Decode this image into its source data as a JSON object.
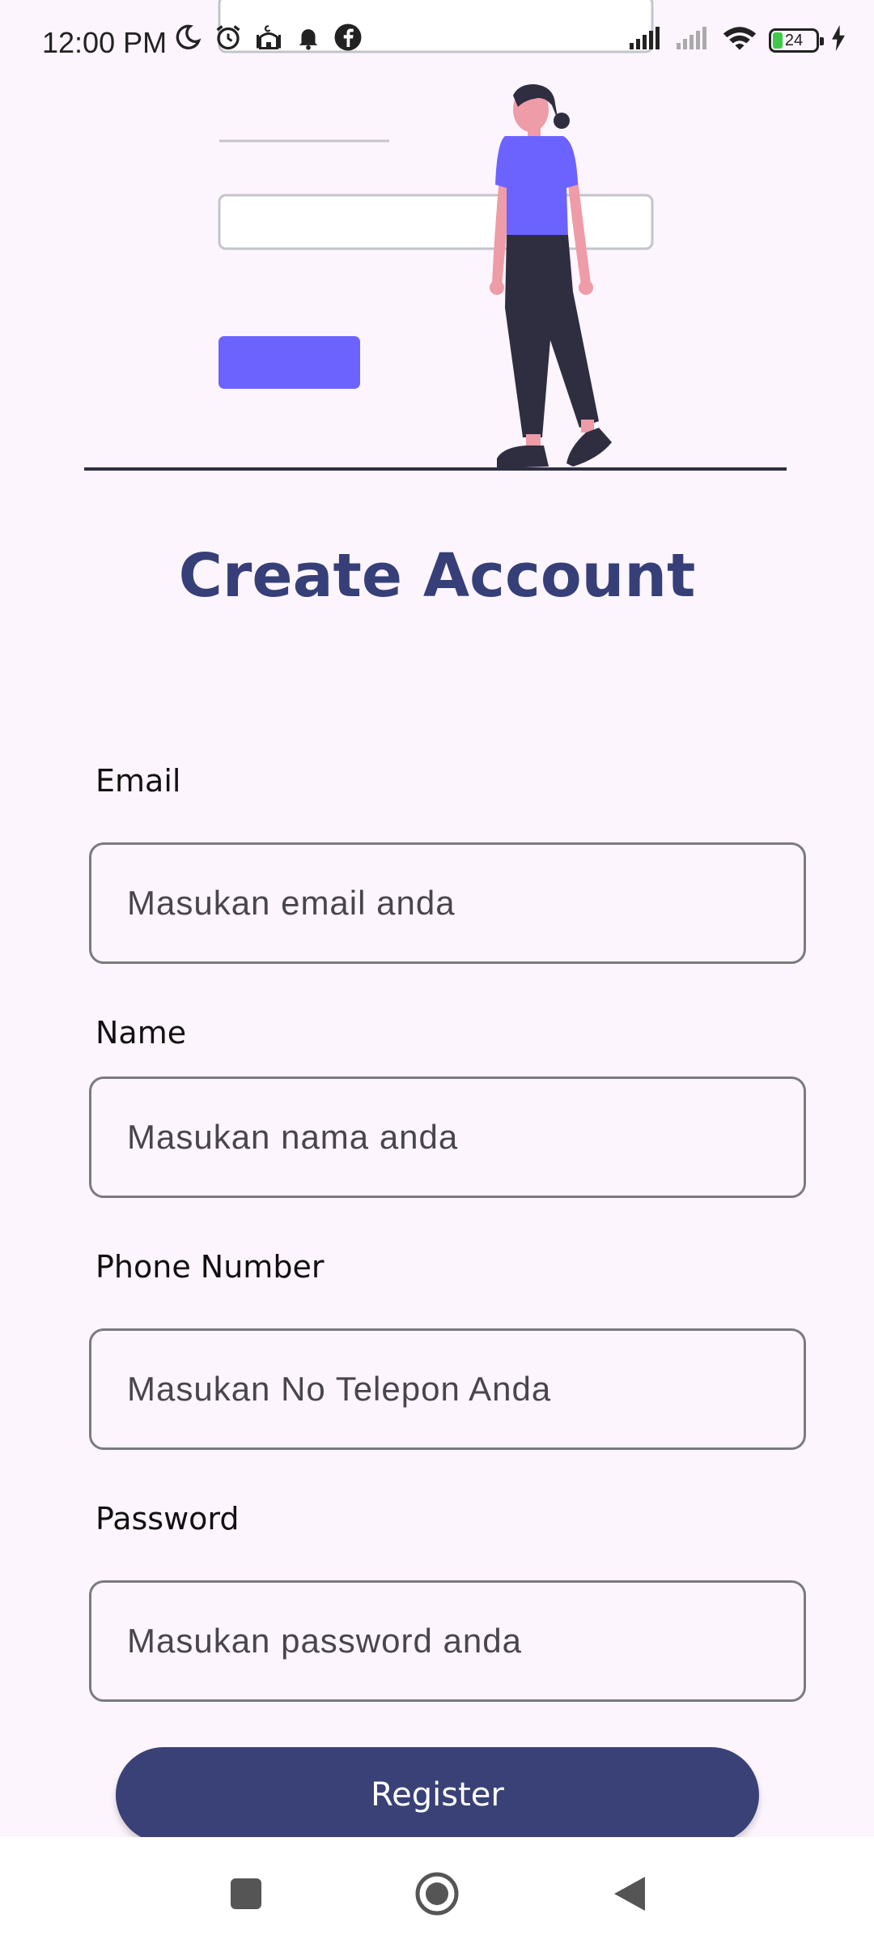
{
  "status_bar": {
    "time": "12:00 PM",
    "battery_level": "24",
    "battery_fraction": 0.24,
    "left_icons": [
      "moon-icon",
      "alarm-icon",
      "mosque-icon",
      "bell-icon",
      "facebook-icon"
    ],
    "right_icons": [
      "signal-icon",
      "signal-weak-icon",
      "wifi-icon",
      "battery-icon",
      "charging-icon"
    ]
  },
  "title": "Create Account",
  "form": {
    "email": {
      "label": "Email",
      "placeholder": "Masukan email anda"
    },
    "name": {
      "label": "Name",
      "placeholder": "Masukan nama anda"
    },
    "phone": {
      "label": "Phone Number",
      "placeholder": "Masukan No Telepon Anda"
    },
    "password": {
      "label": "Password",
      "placeholder": "Masukan password anda"
    }
  },
  "register_label": "Register",
  "nav_bar": {
    "items": [
      "recents-icon",
      "home-icon",
      "back-icon"
    ]
  },
  "colors": {
    "primary": "#394176",
    "title": "#363f77",
    "accent": "#6c63ff",
    "background": "#fdf5fd"
  }
}
